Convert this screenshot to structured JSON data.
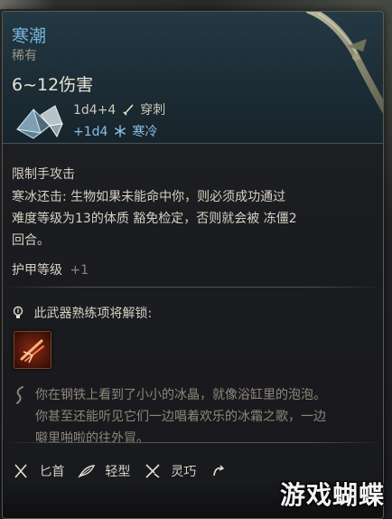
{
  "item": {
    "name": "寒潮",
    "rarity": "稀有",
    "damage": "6~12伤害",
    "damage_lines": [
      {
        "dice": "1d4+4",
        "type": "穿刺",
        "icon": "pierce-icon",
        "color": "#cdc7b8"
      },
      {
        "dice": "+1d4",
        "type": "寒冷",
        "icon": "snowflake-icon",
        "color": "#8bbfe6"
      }
    ]
  },
  "attack": {
    "type": "限制手攻击",
    "description_lines": [
      "寒冰还击: 生物如果未能命中你，则必须成功通过",
      "难度等级为13的体质 豁免检定，否则就会被 冻僵2",
      "回合。"
    ]
  },
  "armor_class": {
    "label": "护甲等级",
    "value": "+1"
  },
  "mastery": {
    "heading": "此武器熟练项将解锁:",
    "skill_icon": "frost-slash-icon"
  },
  "flavor": {
    "lines": [
      "你在钢铁上看到了小小的冰晶，就像浴缸里的泡泡。",
      "你甚至还能听见它们一边唱着欢乐的冰霜之歌，一边",
      "噼里啪啦的往外冒。"
    ]
  },
  "properties": [
    {
      "label": "匕首",
      "icon": "dagger-icon"
    },
    {
      "label": "轻型",
      "icon": "feather-icon"
    },
    {
      "label": "灵巧",
      "icon": "finesse-icon"
    },
    {
      "label": "",
      "icon": "thrown-icon"
    }
  ],
  "watermark": "游戏蝴蝶",
  "colors": {
    "title": "#77b5dc",
    "cold": "#8bbfe6",
    "text": "#d6d0c2",
    "muted": "#8d877a"
  }
}
